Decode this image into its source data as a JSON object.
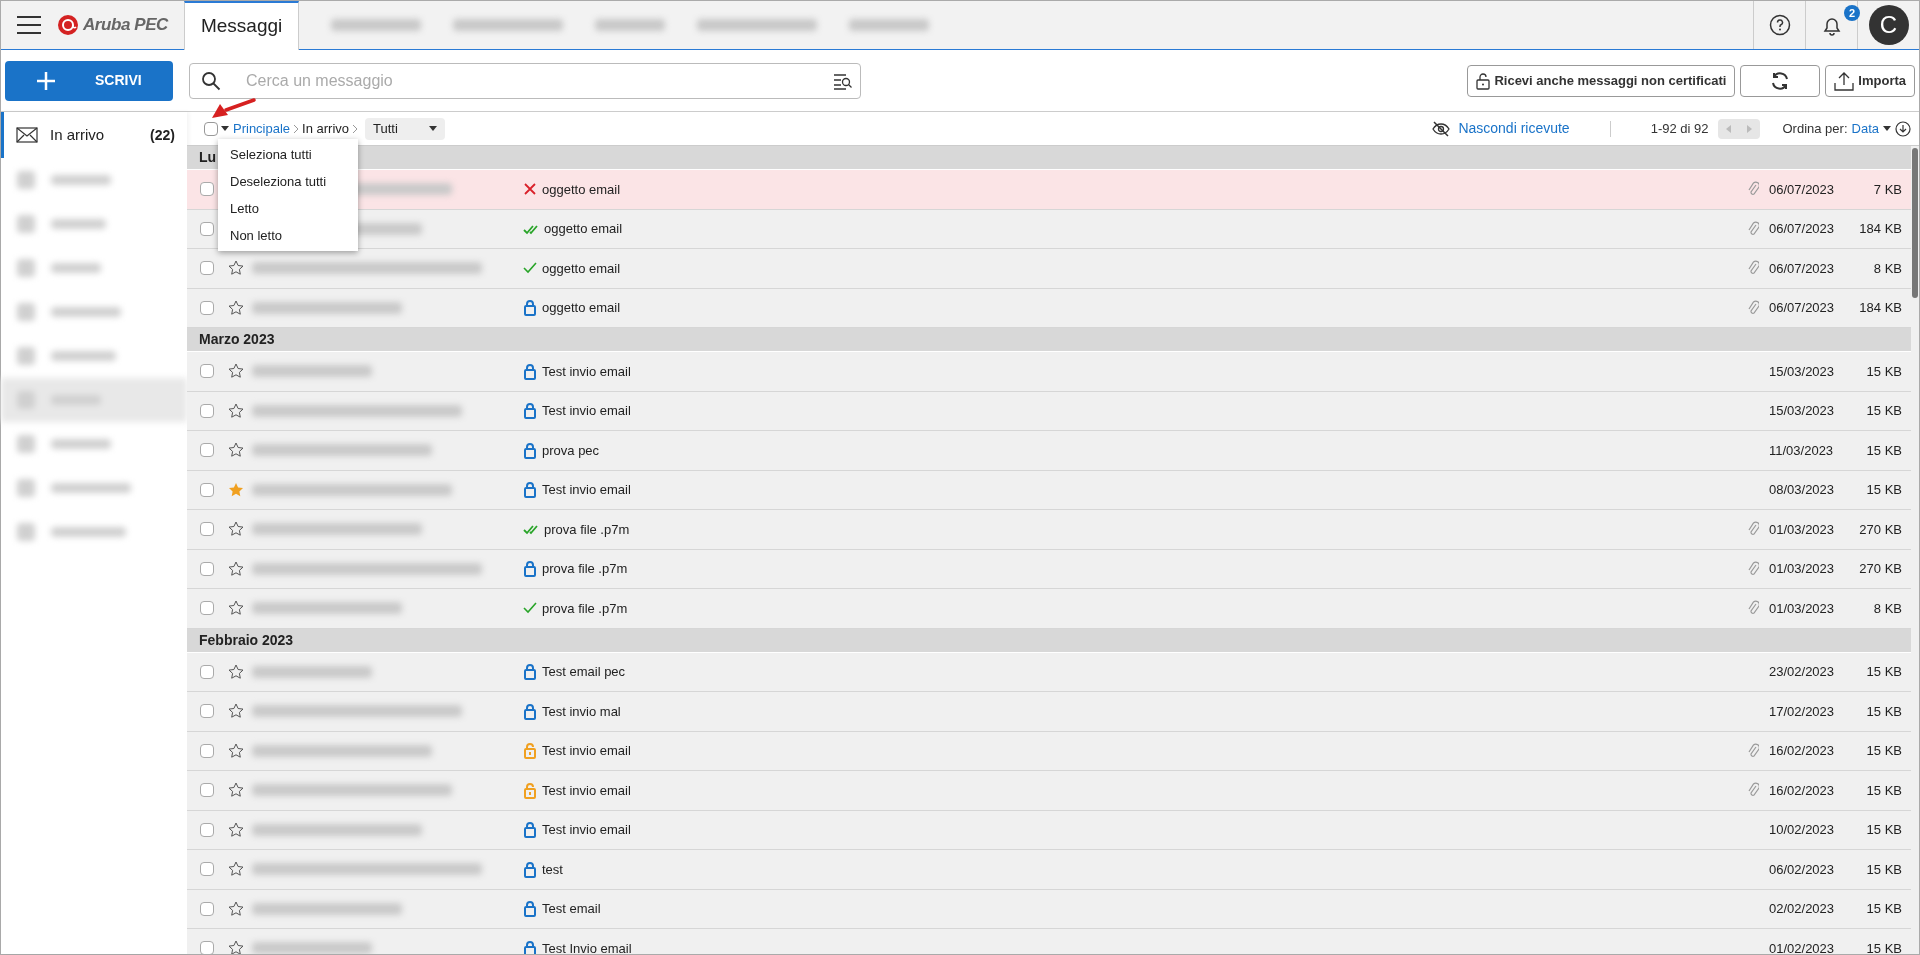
{
  "topbar": {
    "logo": "Aruba PEC",
    "tabs": [
      {
        "label": "Messaggi",
        "selected": true
      }
    ],
    "notifications_badge": "2",
    "avatar": "C"
  },
  "compose_button": "SCRIVI",
  "search": {
    "placeholder": "Cerca un messaggio"
  },
  "actions": [
    {
      "kind": "unlock",
      "label": "Ricevi anche messaggi non certificati"
    },
    {
      "kind": "refresh"
    },
    {
      "kind": "upload",
      "label": "Importa"
    }
  ],
  "sidebar": {
    "items": [
      {
        "label": "In arrivo",
        "count": "(22)",
        "selected": true
      }
    ]
  },
  "toolbar": {
    "select_all_checked": false,
    "breadcrumb": [
      "Principale",
      "In arrivo"
    ],
    "filter": "Tutti",
    "hide_receipts": "Nascondi ricevute",
    "range": "1-92 di 92",
    "sort_label": "Ordina per:",
    "sort_value": "Data"
  },
  "select_menu": [
    "Seleziona tutti",
    "Deseleziona tutti",
    "Letto",
    "Non letto"
  ],
  "groups": [
    {
      "title": "Lu",
      "rows": [
        {
          "checked": false,
          "error": true,
          "kind": "failed",
          "subject": "oggetto email",
          "attachment": true,
          "date": "06/07/2023",
          "size": "7 KB"
        },
        {
          "checked": false,
          "error": false,
          "kind": "delivered",
          "subject": "oggetto email",
          "attachment": true,
          "date": "06/07/2023",
          "size": "184 KB"
        },
        {
          "checked": false,
          "starred": false,
          "error": false,
          "kind": "accepted",
          "subject": "oggetto email",
          "attachment": true,
          "date": "06/07/2023",
          "size": "8 KB"
        },
        {
          "checked": false,
          "starred": false,
          "error": false,
          "kind": "certified",
          "subject": "oggetto email",
          "attachment": true,
          "date": "06/07/2023",
          "size": "184 KB"
        }
      ]
    },
    {
      "title": "Marzo 2023",
      "rows": [
        {
          "checked": false,
          "starred": false,
          "error": false,
          "kind": "certified",
          "subject": "Test invio email",
          "attachment": false,
          "date": "15/03/2023",
          "size": "15 KB"
        },
        {
          "checked": false,
          "starred": false,
          "error": false,
          "kind": "certified",
          "subject": "Test invio email",
          "attachment": false,
          "date": "15/03/2023",
          "size": "15 KB"
        },
        {
          "checked": false,
          "starred": false,
          "error": false,
          "kind": "certified",
          "subject": "prova pec",
          "attachment": false,
          "date": "11/03/2023",
          "size": "15 KB"
        },
        {
          "checked": false,
          "starred": true,
          "error": false,
          "kind": "certified",
          "subject": "Test invio email",
          "attachment": false,
          "date": "08/03/2023",
          "size": "15 KB"
        },
        {
          "checked": false,
          "starred": false,
          "error": false,
          "kind": "delivered",
          "subject": "prova file .p7m",
          "attachment": true,
          "date": "01/03/2023",
          "size": "270 KB"
        },
        {
          "checked": false,
          "starred": false,
          "error": false,
          "kind": "certified",
          "subject": "prova file .p7m",
          "attachment": true,
          "date": "01/03/2023",
          "size": "270 KB"
        },
        {
          "checked": false,
          "starred": false,
          "error": false,
          "kind": "accepted",
          "subject": "prova file .p7m",
          "attachment": true,
          "date": "01/03/2023",
          "size": "8 KB"
        }
      ]
    },
    {
      "title": "Febbraio 2023",
      "rows": [
        {
          "checked": false,
          "starred": false,
          "error": false,
          "kind": "certified",
          "subject": "Test email pec",
          "attachment": false,
          "date": "23/02/2023",
          "size": "15 KB"
        },
        {
          "checked": false,
          "starred": false,
          "error": false,
          "kind": "certified",
          "subject": "Test invio mal",
          "attachment": false,
          "date": "17/02/2023",
          "size": "15 KB"
        },
        {
          "checked": false,
          "starred": false,
          "error": false,
          "kind": "uncertified",
          "subject": "Test invio email",
          "attachment": true,
          "date": "16/02/2023",
          "size": "15 KB"
        },
        {
          "checked": false,
          "starred": false,
          "error": false,
          "kind": "uncertified",
          "subject": "Test invio email",
          "attachment": true,
          "date": "16/02/2023",
          "size": "15 KB"
        },
        {
          "checked": false,
          "starred": false,
          "error": false,
          "kind": "certified",
          "subject": "Test invio email",
          "attachment": false,
          "date": "10/02/2023",
          "size": "15 KB"
        },
        {
          "checked": false,
          "starred": false,
          "error": false,
          "kind": "certified",
          "subject": "test",
          "attachment": false,
          "date": "06/02/2023",
          "size": "15 KB"
        },
        {
          "checked": false,
          "starred": false,
          "error": false,
          "kind": "certified",
          "subject": "Test email",
          "attachment": false,
          "date": "02/02/2023",
          "size": "15 KB"
        },
        {
          "checked": false,
          "starred": false,
          "error": false,
          "kind": "certified",
          "subject": "Test Invio email",
          "attachment": false,
          "date": "01/02/2023",
          "size": "15 KB"
        }
      ]
    }
  ]
}
